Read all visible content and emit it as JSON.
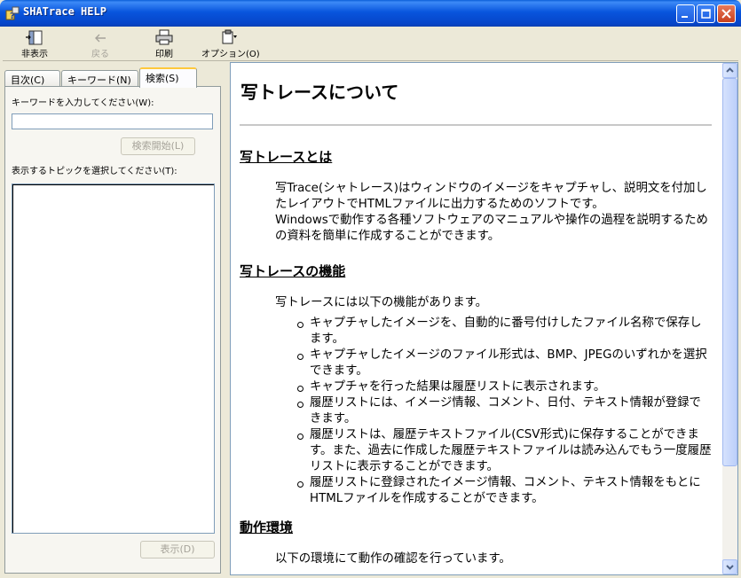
{
  "window": {
    "title": "SHATrace HELP",
    "colors": {
      "titlebar": "#0855dd",
      "close": "#d8542c",
      "list_border": "#7f9db9"
    }
  },
  "toolbar": {
    "hide": {
      "label": "非表示",
      "icon": "hide-panel-icon"
    },
    "back": {
      "label": "戻る",
      "icon": "back-arrow-icon"
    },
    "print": {
      "label": "印刷",
      "icon": "printer-icon"
    },
    "options": {
      "label": "オプション(O)",
      "icon": "options-icon"
    }
  },
  "sidebar": {
    "tabs": [
      {
        "label": "目次(C)"
      },
      {
        "label": "キーワード(N)"
      },
      {
        "label": "検索(S)"
      }
    ],
    "keyword_label": "キーワードを入力してください(W):",
    "keyword_value": "",
    "search_button": "検索開始(L)",
    "topic_label": "表示するトピックを選択してください(T):",
    "display_button": "表示(D)"
  },
  "content": {
    "title": "写トレースについて",
    "section1": {
      "heading": "写トレースとは",
      "p1": "写Trace(シャトレース)はウィンドウのイメージをキャプチャし、説明文を付加したレイアウトでHTMLファイルに出力するためのソフトです。",
      "p2": "Windowsで動作する各種ソフトウェアのマニュアルや操作の過程を説明するための資料を簡単に作成することができます。"
    },
    "section2": {
      "heading": "写トレースの機能",
      "intro": "写トレースには以下の機能があります。",
      "items": [
        "キャプチャしたイメージを、自動的に番号付けしたファイル名称で保存します。",
        "キャプチャしたイメージのファイル形式は、BMP、JPEGのいずれかを選択できます。",
        "キャプチャを行った結果は履歴リストに表示されます。",
        "履歴リストには、イメージ情報、コメント、日付、テキスト情報が登録できます。",
        "履歴リストは、履歴テキストファイル(CSV形式)に保存することができます。また、過去に作成した履歴テキストファイルは読み込んでもう一度履歴リストに表示することができます。",
        "履歴リストに登録されたイメージ情報、コメント、テキスト情報をもとにHTMLファイルを作成することができます。"
      ]
    },
    "section3": {
      "heading": "動作環境",
      "intro": "以下の環境にて動作の確認を行っています。"
    }
  }
}
